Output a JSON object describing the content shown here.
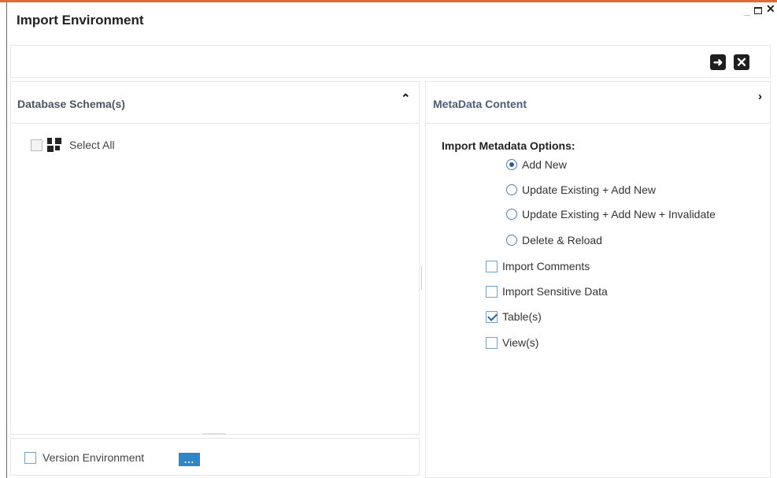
{
  "window": {
    "title": "Import Environment",
    "controls": [
      "minimize",
      "maximize",
      "close"
    ]
  },
  "toolbar": {
    "buttons": [
      {
        "icon": "arrow-right-icon"
      },
      {
        "icon": "close-icon"
      }
    ]
  },
  "schema_panel": {
    "title": "Database Schema(s)",
    "select_all": {
      "label": "Select All",
      "checked": false
    }
  },
  "version": {
    "label": "Version Environment",
    "checked": false,
    "button_text": "..."
  },
  "metadata_panel": {
    "title": "MetaData Content",
    "options_title": "Import Metadata Options:",
    "radios": [
      {
        "label": "Add New",
        "checked": true
      },
      {
        "label": "Update Existing + Add New",
        "checked": false
      },
      {
        "label": "Update Existing + Add New + Invalidate",
        "checked": false
      },
      {
        "label": "Delete & Reload",
        "checked": false
      }
    ],
    "checkboxes": [
      {
        "label": "Import Comments",
        "checked": false
      },
      {
        "label": "Import Sensitive Data",
        "checked": false
      },
      {
        "label": "Table(s)",
        "checked": true
      },
      {
        "label": "View(s)",
        "checked": false
      }
    ]
  },
  "colors": {
    "accent": "#e0693a",
    "primary_button": "#2e86c9",
    "dark_button": "#1f1f1f"
  }
}
